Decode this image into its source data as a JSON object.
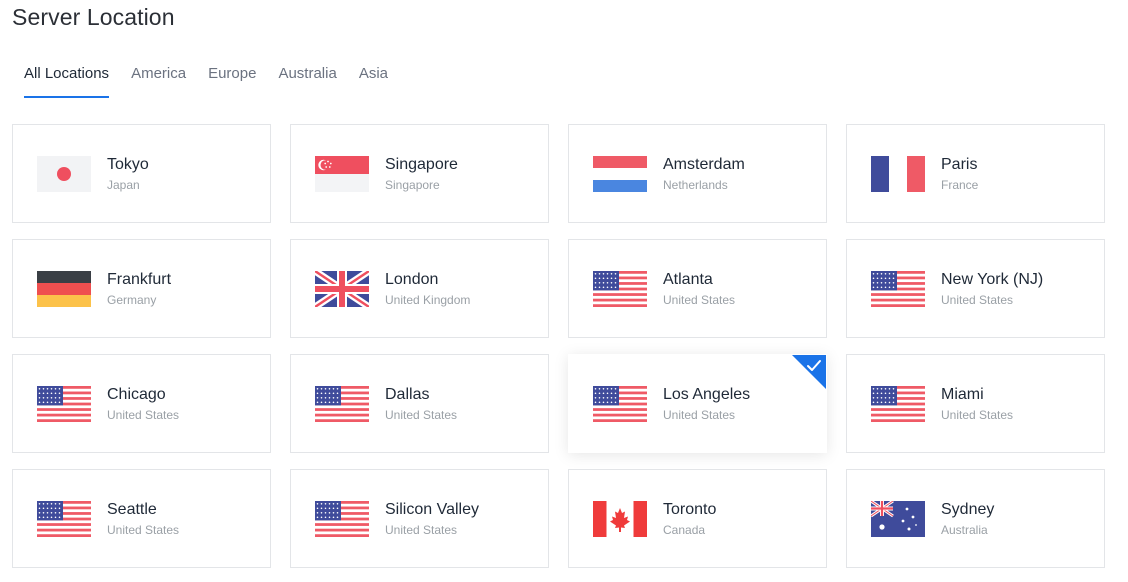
{
  "page": {
    "title": "Server Location"
  },
  "tabs": [
    {
      "label": "All Locations",
      "active": true
    },
    {
      "label": "America",
      "active": false
    },
    {
      "label": "Europe",
      "active": false
    },
    {
      "label": "Australia",
      "active": false
    },
    {
      "label": "Asia",
      "active": false
    }
  ],
  "locations": [
    {
      "city": "Tokyo",
      "country": "Japan",
      "flag": "jp",
      "selected": false
    },
    {
      "city": "Singapore",
      "country": "Singapore",
      "flag": "sg",
      "selected": false
    },
    {
      "city": "Amsterdam",
      "country": "Netherlands",
      "flag": "nl",
      "selected": false
    },
    {
      "city": "Paris",
      "country": "France",
      "flag": "fr",
      "selected": false
    },
    {
      "city": "Frankfurt",
      "country": "Germany",
      "flag": "de",
      "selected": false
    },
    {
      "city": "London",
      "country": "United Kingdom",
      "flag": "gb",
      "selected": false
    },
    {
      "city": "Atlanta",
      "country": "United States",
      "flag": "us",
      "selected": false
    },
    {
      "city": "New York (NJ)",
      "country": "United States",
      "flag": "us",
      "selected": false
    },
    {
      "city": "Chicago",
      "country": "United States",
      "flag": "us",
      "selected": false
    },
    {
      "city": "Dallas",
      "country": "United States",
      "flag": "us",
      "selected": false
    },
    {
      "city": "Los Angeles",
      "country": "United States",
      "flag": "us",
      "selected": true
    },
    {
      "city": "Miami",
      "country": "United States",
      "flag": "us",
      "selected": false
    },
    {
      "city": "Seattle",
      "country": "United States",
      "flag": "us",
      "selected": false
    },
    {
      "city": "Silicon Valley",
      "country": "United States",
      "flag": "us",
      "selected": false
    },
    {
      "city": "Toronto",
      "country": "Canada",
      "flag": "ca",
      "selected": false
    },
    {
      "city": "Sydney",
      "country": "Australia",
      "flag": "au",
      "selected": false
    }
  ],
  "colors": {
    "accent": "#1a73e8",
    "card_border": "#e3e5e8",
    "flag_red": "#ef5a66",
    "flag_blue": "#3f4b9b"
  },
  "icons": {
    "selected_marker": "check-icon"
  }
}
